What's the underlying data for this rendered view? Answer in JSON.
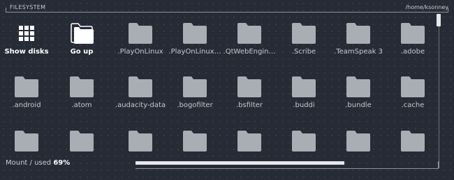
{
  "header": {
    "title": "FILESYSTEM",
    "path": "/home/ksonney"
  },
  "items": [
    {
      "label": "Show disks",
      "icon": "grid-icon",
      "kind": "action"
    },
    {
      "label": "Go up",
      "icon": "folder-up-icon",
      "kind": "action"
    },
    {
      "label": ".PlayOnLinux",
      "icon": "folder-icon",
      "kind": "folder"
    },
    {
      "label": ".PlayOnLinux…",
      "icon": "folder-icon",
      "kind": "folder"
    },
    {
      "label": ".QtWebEngin…",
      "icon": "folder-icon",
      "kind": "folder"
    },
    {
      "label": ".Scribe",
      "icon": "folder-icon",
      "kind": "folder"
    },
    {
      "label": ".TeamSpeak 3",
      "icon": "folder-icon",
      "kind": "folder"
    },
    {
      "label": ".adobe",
      "icon": "folder-icon",
      "kind": "folder"
    },
    {
      "label": ".android",
      "icon": "folder-icon",
      "kind": "folder"
    },
    {
      "label": ".atom",
      "icon": "folder-icon",
      "kind": "folder"
    },
    {
      "label": ".audacity-data",
      "icon": "folder-icon",
      "kind": "folder"
    },
    {
      "label": ".bogofilter",
      "icon": "folder-icon",
      "kind": "folder"
    },
    {
      "label": ".bsfilter",
      "icon": "folder-icon",
      "kind": "folder"
    },
    {
      "label": ".buddi",
      "icon": "folder-icon",
      "kind": "folder"
    },
    {
      "label": ".bundle",
      "icon": "folder-icon",
      "kind": "folder"
    },
    {
      "label": ".cache",
      "icon": "folder-icon",
      "kind": "folder"
    },
    {
      "label": "",
      "icon": "folder-icon",
      "kind": "folder"
    },
    {
      "label": "",
      "icon": "folder-icon",
      "kind": "folder"
    },
    {
      "label": "",
      "icon": "folder-icon",
      "kind": "folder"
    },
    {
      "label": "",
      "icon": "folder-icon",
      "kind": "folder"
    },
    {
      "label": "",
      "icon": "folder-icon",
      "kind": "folder"
    },
    {
      "label": "",
      "icon": "folder-icon",
      "kind": "folder"
    },
    {
      "label": "",
      "icon": "folder-icon",
      "kind": "folder"
    },
    {
      "label": "",
      "icon": "folder-icon",
      "kind": "folder"
    }
  ],
  "footer": {
    "mount_text": "Mount / used",
    "used_percent_text": "69%",
    "used_fraction": 0.69
  },
  "colors": {
    "background": "#262b35",
    "folder": "#a9adb4",
    "text": "#c5c9cf",
    "accent": "#e6e8eb"
  }
}
